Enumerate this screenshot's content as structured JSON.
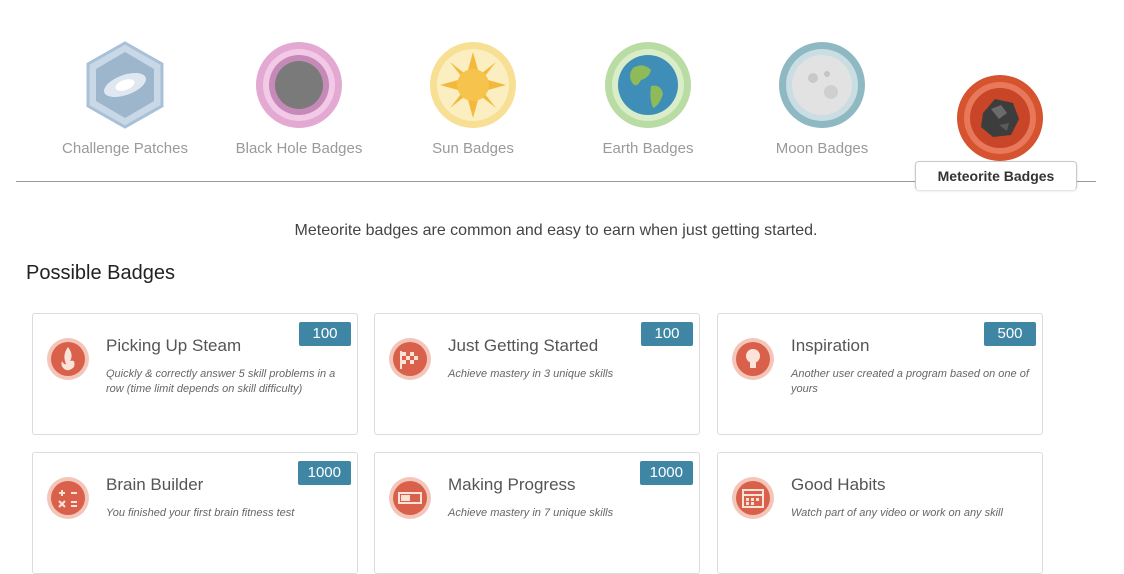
{
  "categories": [
    {
      "label": "Challenge Patches",
      "icon": "challenge-patch-icon"
    },
    {
      "label": "Black Hole Badges",
      "icon": "black-hole-icon"
    },
    {
      "label": "Sun Badges",
      "icon": "sun-icon"
    },
    {
      "label": "Earth Badges",
      "icon": "earth-icon"
    },
    {
      "label": "Moon Badges",
      "icon": "moon-icon"
    },
    {
      "label": "Meteorite Badges",
      "icon": "meteorite-icon"
    }
  ],
  "active_category": "Meteorite Badges",
  "description": "Meteorite badges are common and easy to earn when just getting started.",
  "section_title": "Possible Badges",
  "badges": [
    {
      "title": "Picking Up Steam",
      "points": "100",
      "desc": "Quickly & correctly answer 5 skill problems in a row (time limit depends on skill difficulty)",
      "icon": "flame-icon"
    },
    {
      "title": "Just Getting Started",
      "points": "100",
      "desc": "Achieve mastery in 3 unique skills",
      "icon": "checkered-flag-icon"
    },
    {
      "title": "Inspiration",
      "points": "500",
      "desc": "Another user created a program based on one of yours",
      "icon": "lightbulb-icon"
    },
    {
      "title": "Brain Builder",
      "points": "1000",
      "desc": "You finished your first brain fitness test",
      "icon": "calculator-icon"
    },
    {
      "title": "Making Progress",
      "points": "1000",
      "desc": "Achieve mastery in 7 unique skills",
      "icon": "progress-bar-icon"
    },
    {
      "title": "Good Habits",
      "points": "",
      "desc": "Watch part of any video or work on any skill",
      "icon": "calendar-icon"
    }
  ],
  "colors": {
    "points_bg": "#3f86a5",
    "badge_red": "#d9604a",
    "badge_ring": "#f3c6b9"
  }
}
